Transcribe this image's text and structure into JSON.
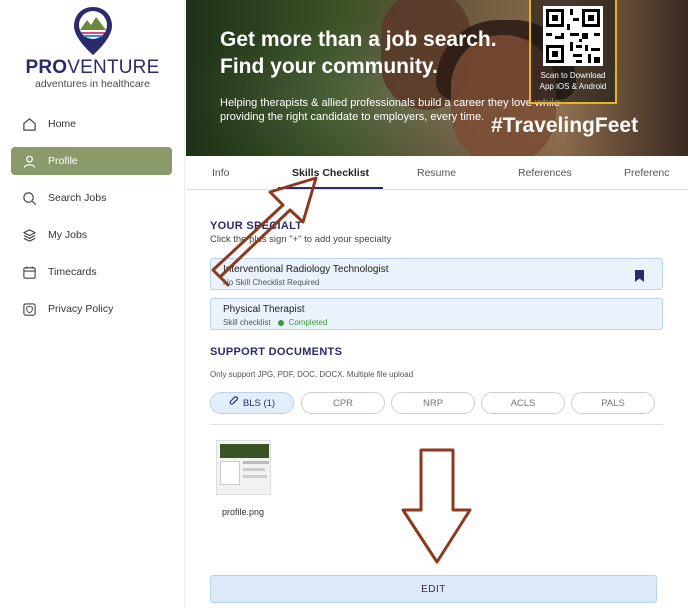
{
  "brand": {
    "name_bold": "PRO",
    "name_rest": "VENTURE",
    "tagline": "adventures in healthcare"
  },
  "sidebar": {
    "items": [
      {
        "label": "Home",
        "icon": "home-icon"
      },
      {
        "label": "Profile",
        "icon": "user-icon",
        "active": true
      },
      {
        "label": "Search Jobs",
        "icon": "search-icon"
      },
      {
        "label": "My Jobs",
        "icon": "layers-icon"
      },
      {
        "label": "Timecards",
        "icon": "calendar-icon"
      },
      {
        "label": "Privacy Policy",
        "icon": "shield-icon"
      }
    ],
    "active_color": "#8a9a6a"
  },
  "banner": {
    "headline_1": "Get more than a job search.",
    "headline_2": "Find your community.",
    "subtext": "Helping therapists & allied professionals build a career they love while providing the right candidate to employers, every time.",
    "hashtag": "#TravelingFeet",
    "qr_caption_1": "Scan to Download",
    "qr_caption_2": "App iOS & Android"
  },
  "tabs": [
    {
      "label": "Info"
    },
    {
      "label": "Skills Checklist",
      "active": true
    },
    {
      "label": "Resume"
    },
    {
      "label": "References"
    },
    {
      "label": "Preferenc"
    }
  ],
  "specialty": {
    "title": "YOUR SPECIALT",
    "hint": "Click the plus sign \"+\" to add your specialty",
    "items": [
      {
        "title": "Interventional Radiology Technologist",
        "sub": "No Skill Checklist Required",
        "status": ""
      },
      {
        "title": "Physical Therapist",
        "sub": "Skill checklist",
        "status": "Completed"
      }
    ]
  },
  "support_docs": {
    "title": "SUPPORT DOCUMENTS",
    "hint": "Only support JPG, PDF, DOC, DOCX. Multiple file upload",
    "chips": [
      {
        "label": "BLS (1)",
        "active": true
      },
      {
        "label": "CPR"
      },
      {
        "label": "NRP"
      },
      {
        "label": "ACLS"
      },
      {
        "label": "PALS"
      }
    ],
    "file_name": "profile.png"
  },
  "actions": {
    "edit_label": "EDIT"
  },
  "colors": {
    "brand_navy": "#2b2a6b",
    "card_bg": "#eaf2fb",
    "arrow": "#8b3a1e",
    "completed": "#3a9a3a"
  }
}
